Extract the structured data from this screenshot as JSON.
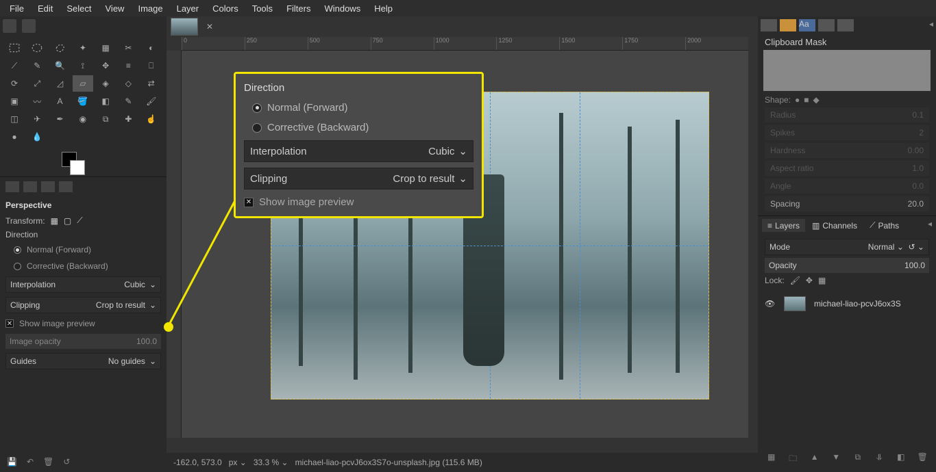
{
  "menu": [
    "File",
    "Edit",
    "Select",
    "View",
    "Image",
    "Layer",
    "Colors",
    "Tools",
    "Filters",
    "Windows",
    "Help"
  ],
  "tool_options": {
    "title": "Perspective",
    "transform_label": "Transform:",
    "direction_label": "Direction",
    "dir_normal": "Normal (Forward)",
    "dir_corrective": "Corrective (Backward)",
    "interp_label": "Interpolation",
    "interp_value": "Cubic",
    "clip_label": "Clipping",
    "clip_value": "Crop to result",
    "preview_label": "Show image preview",
    "opacity_label": "Image opacity",
    "opacity_value": "100.0",
    "guides_label": "Guides",
    "guides_value": "No guides"
  },
  "callout": {
    "direction_label": "Direction",
    "dir_normal": "Normal (Forward)",
    "dir_corrective": "Corrective (Backward)",
    "interp_label": "Interpolation",
    "interp_value": "Cubic",
    "clip_label": "Clipping",
    "clip_value": "Crop to result",
    "preview_label": "Show image preview"
  },
  "ruler_h": [
    "0",
    "250",
    "500",
    "750",
    "1000",
    "1250",
    "1500",
    "1750",
    "2000"
  ],
  "status": {
    "coords": "-162.0, 573.0",
    "unit": "px",
    "zoom": "33.3 %",
    "filename": "michael-liao-pcvJ6ox3S7o-unsplash.jpg (115.6 MB)"
  },
  "right": {
    "clipboard": "Clipboard Mask",
    "shape_label": "Shape:",
    "props": [
      {
        "k": "Radius",
        "v": "0.1"
      },
      {
        "k": "Spikes",
        "v": "2"
      },
      {
        "k": "Hardness",
        "v": "0.00"
      },
      {
        "k": "Aspect ratio",
        "v": "1.0"
      },
      {
        "k": "Angle",
        "v": "0.0"
      },
      {
        "k": "Spacing",
        "v": "20.0"
      }
    ],
    "layers_tab": "Layers",
    "channels_tab": "Channels",
    "paths_tab": "Paths",
    "mode_label": "Mode",
    "mode_value": "Normal",
    "opacity_label": "Opacity",
    "opacity_value": "100.0",
    "lock_label": "Lock:",
    "layer_name": "michael-liao-pcvJ6ox3S"
  }
}
